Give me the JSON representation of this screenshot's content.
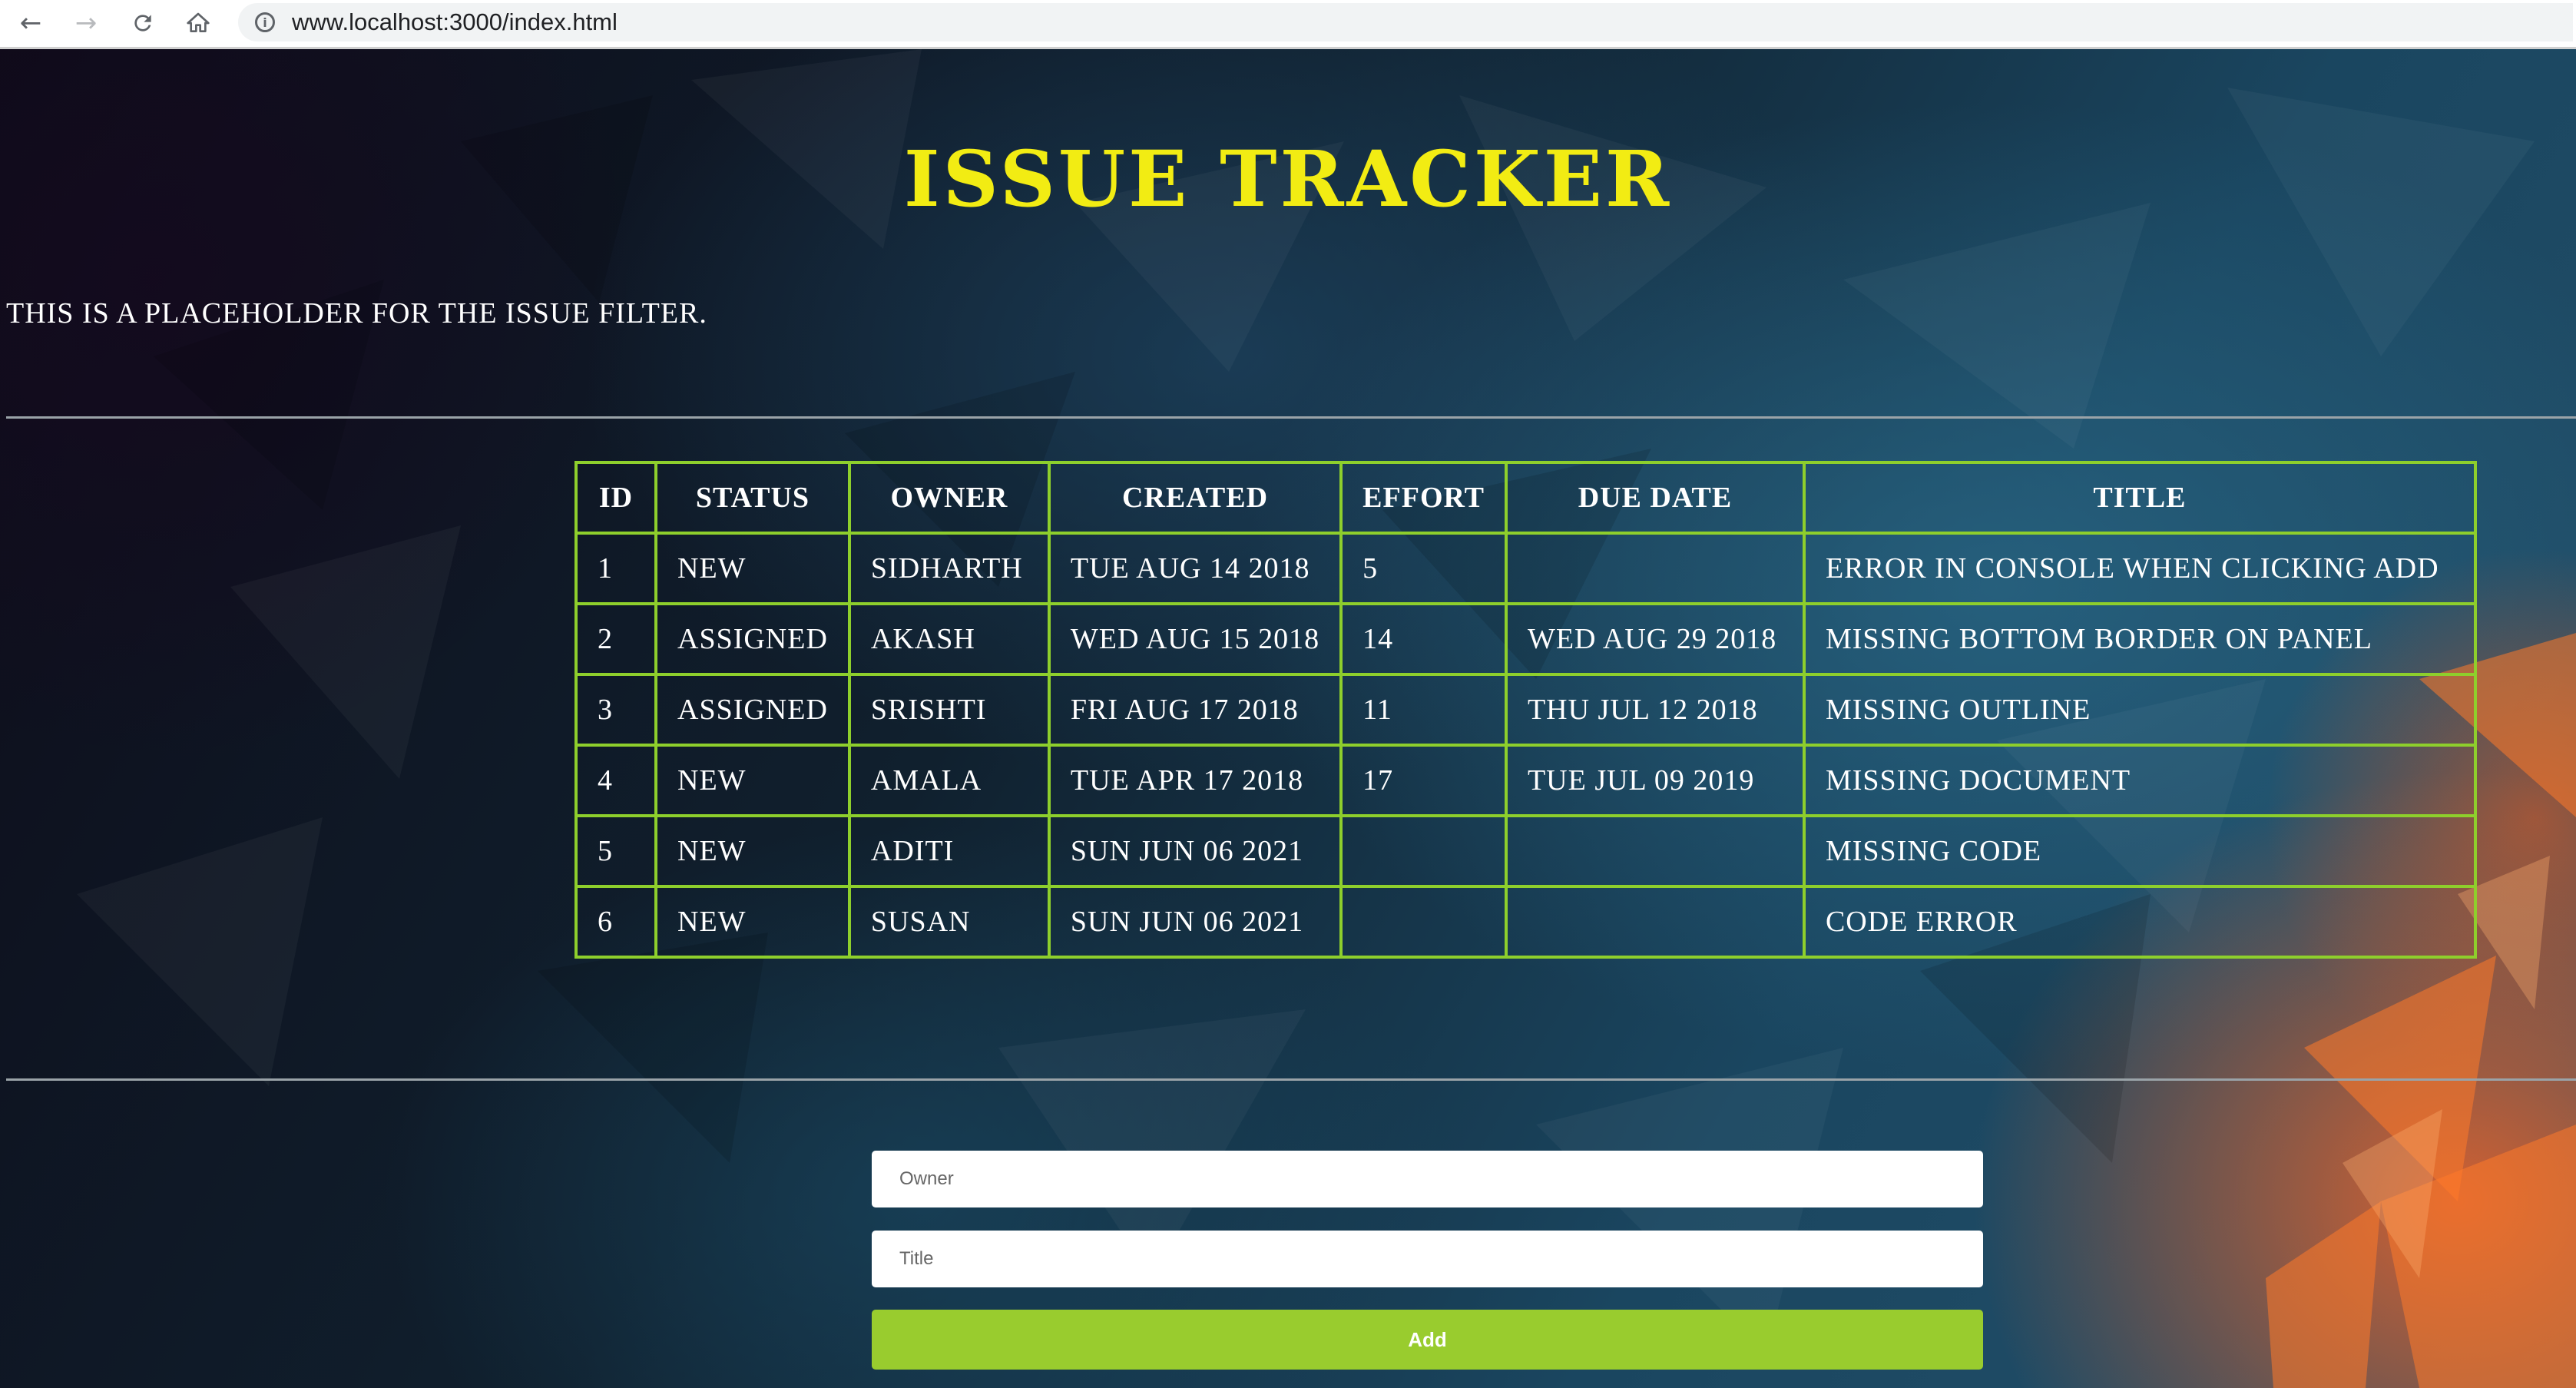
{
  "browser": {
    "url": "www.localhost:3000/index.html",
    "back_icon": "arrow-left-icon",
    "forward_icon": "arrow-right-icon",
    "reload_icon": "reload-icon",
    "home_icon": "home-icon",
    "info_icon": "info-icon"
  },
  "header": {
    "title": "ISSUE TRACKER",
    "title_color": "#f2ec13"
  },
  "filter": {
    "placeholder_text": "This is a placeholder for the issue filter."
  },
  "table": {
    "border_color": "#8ecf2c",
    "columns": [
      "ID",
      "STATUS",
      "OWNER",
      "CREATED",
      "EFFORT",
      "DUE DATE",
      "TITLE"
    ],
    "rows": [
      {
        "id": "1",
        "status": "NEW",
        "owner": "SIDHARTH",
        "created": "TUE AUG 14 2018",
        "effort": "5",
        "due": "",
        "title": "ERROR IN CONSOLE WHEN CLICKING ADD"
      },
      {
        "id": "2",
        "status": "ASSIGNED",
        "owner": "AKASH",
        "created": "WED AUG 15 2018",
        "effort": "14",
        "due": "WED AUG 29 2018",
        "title": "MISSING BOTTOM BORDER ON PANEL"
      },
      {
        "id": "3",
        "status": "ASSIGNED",
        "owner": "SRISHTI",
        "created": "FRI AUG 17 2018",
        "effort": "11",
        "due": "THU JUL 12 2018",
        "title": "MISSING OUTLINE"
      },
      {
        "id": "4",
        "status": "NEW",
        "owner": "AMALA",
        "created": "TUE APR 17 2018",
        "effort": "17",
        "due": "TUE JUL 09 2019",
        "title": "MISSING DOCUMENT"
      },
      {
        "id": "5",
        "status": "NEW",
        "owner": "ADITI",
        "created": "SUN JUN 06 2021",
        "effort": "",
        "due": "",
        "title": "MISSING CODE"
      },
      {
        "id": "6",
        "status": "NEW",
        "owner": "SUSAN",
        "created": "SUN JUN 06 2021",
        "effort": "",
        "due": "",
        "title": "CODE ERROR"
      }
    ]
  },
  "form": {
    "owner_placeholder": "Owner",
    "title_placeholder": "Title",
    "add_label": "Add",
    "add_color": "#99cc2e"
  }
}
